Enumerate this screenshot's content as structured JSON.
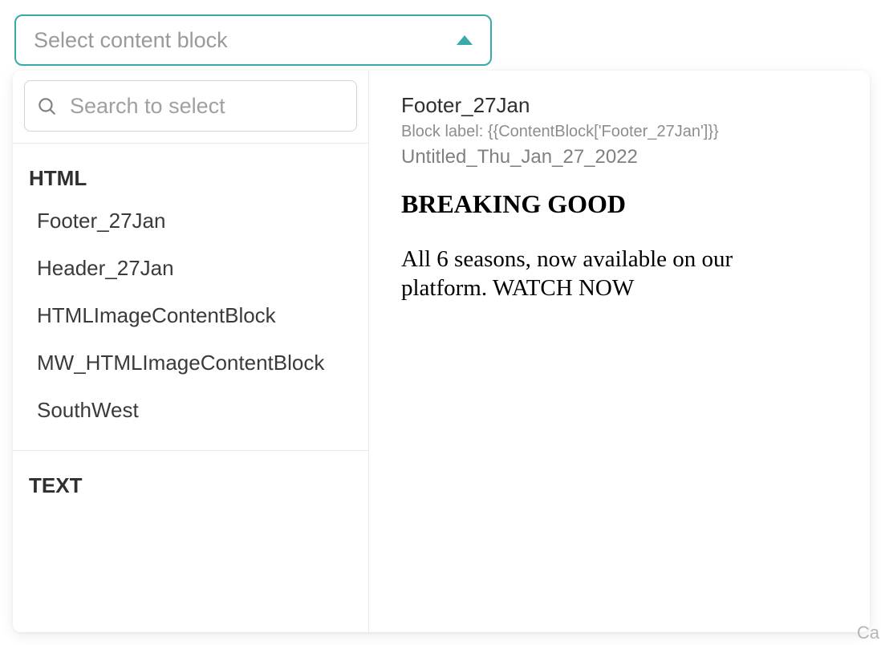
{
  "combo": {
    "placeholder": "Select content block"
  },
  "search": {
    "placeholder": "Search to select"
  },
  "groups": [
    {
      "label": "HTML",
      "items": [
        "Footer_27Jan",
        "Header_27Jan",
        "HTMLImageContentBlock",
        "MW_HTMLImageContentBlock",
        "SouthWest"
      ]
    },
    {
      "label": "TEXT",
      "items": []
    }
  ],
  "preview": {
    "title": "Footer_27Jan",
    "block_label": "Block label: {{ContentBlock['Footer_27Jan']}}",
    "subtitle": "Untitled_Thu_Jan_27_2022",
    "heading": "BREAKING GOOD",
    "body": "All 6 seasons, now available on our platform. WATCH NOW"
  },
  "corner_text": "Ca"
}
